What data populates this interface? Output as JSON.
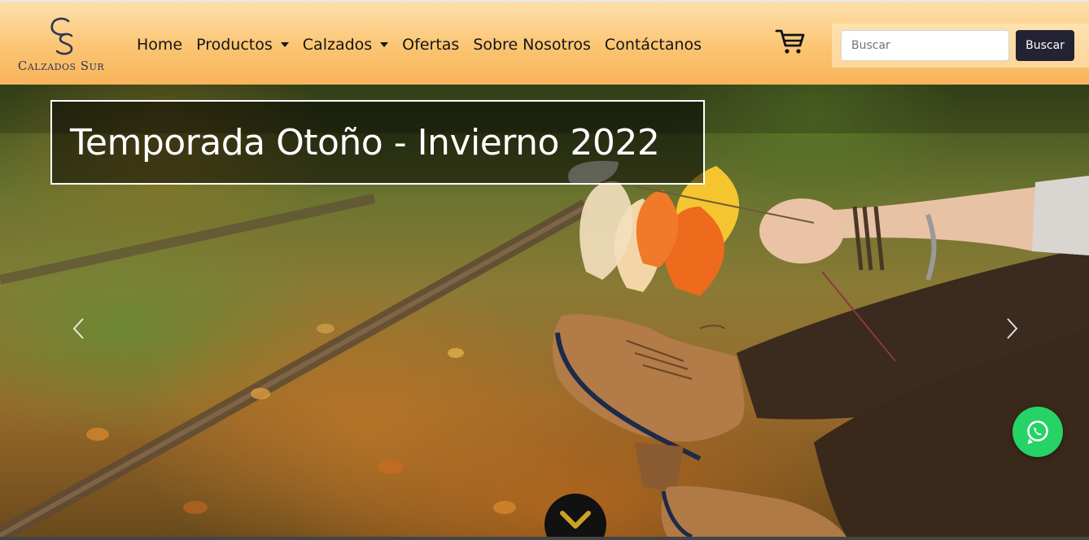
{
  "brand": {
    "name": "Calzados Sur",
    "monogram": "CS"
  },
  "nav": {
    "items": [
      {
        "label": "Home",
        "dropdown": false
      },
      {
        "label": "Productos",
        "dropdown": true
      },
      {
        "label": "Calzados",
        "dropdown": true
      },
      {
        "label": "Ofertas",
        "dropdown": false
      },
      {
        "label": "Sobre Nosotros",
        "dropdown": false
      },
      {
        "label": "Contáctanos",
        "dropdown": false
      }
    ],
    "cart_icon": "cart-icon"
  },
  "search": {
    "placeholder": "Buscar",
    "value": "",
    "button_label": "Buscar"
  },
  "hero": {
    "caption": "Temporada Otoño - Invierno 2022",
    "prev_icon": "chevron-left-icon",
    "next_icon": "chevron-right-icon",
    "scroll_icon": "chevron-down-icon"
  },
  "floating": {
    "whatsapp_icon": "whatsapp-icon"
  },
  "colors": {
    "nav_gradient_top": "#fde0ad",
    "nav_gradient_bottom": "#f8b45b",
    "brand_text": "#2c3558",
    "search_button": "#232333",
    "whatsapp": "#25d366",
    "scroll_arrow": "#c9a227"
  }
}
